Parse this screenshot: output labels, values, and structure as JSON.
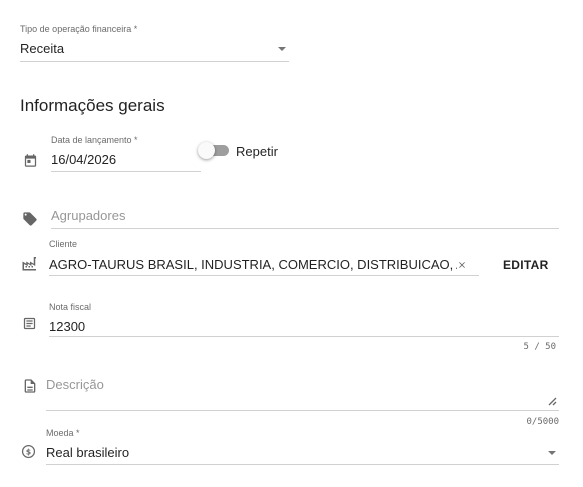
{
  "operation_type": {
    "label": "Tipo de operação financeira *",
    "value": "Receita"
  },
  "section_title": "Informações gerais",
  "launch_date": {
    "label": "Data de lançamento *",
    "value": "16/04/2026"
  },
  "repeat": {
    "label": "Repetir",
    "checked": false
  },
  "groupers": {
    "placeholder": "Agrupadores"
  },
  "client": {
    "label": "Cliente",
    "value": "AGRO-TAURUS BRASIL, INDUSTRIA, COMERCIO, DISTRIBUICAO, AGRO",
    "edit_label": "EDITAR"
  },
  "invoice": {
    "label": "Nota fiscal",
    "value": "12300",
    "counter": "5 / 50"
  },
  "description": {
    "placeholder": "Descrição",
    "counter": "0/5000"
  },
  "currency": {
    "label": "Moeda *",
    "value": "Real brasileiro"
  },
  "icons": [
    "calendar-icon",
    "tag-icon",
    "factory-icon",
    "receipt-icon",
    "document-icon",
    "dollar-circle-icon",
    "chevron-down-icon",
    "clear-icon",
    "resize-handle-icon"
  ]
}
